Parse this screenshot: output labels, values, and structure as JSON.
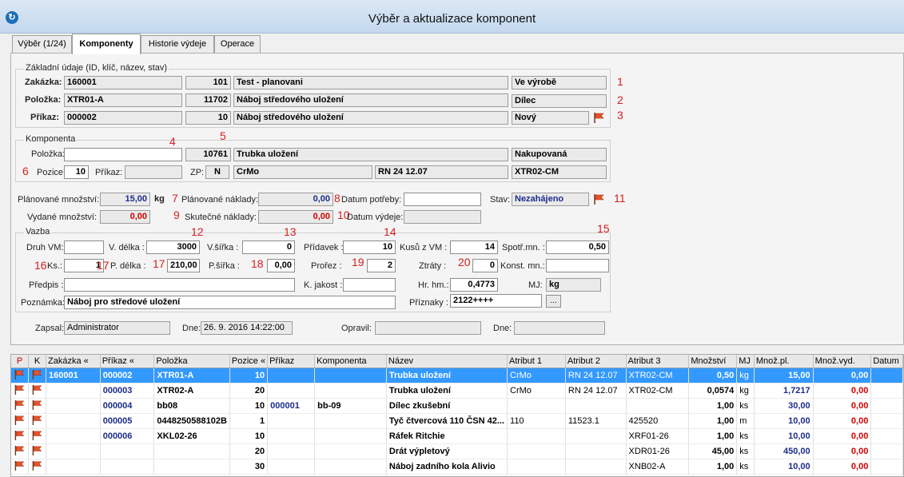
{
  "window": {
    "title": "Výběr a aktualizace komponent",
    "icon": "app-logo-icon"
  },
  "tabs": [
    {
      "label": "Výběr (1/24)"
    },
    {
      "label": "Komponenty",
      "active": true
    },
    {
      "label": "Historie výdeje"
    },
    {
      "label": "Operace"
    }
  ],
  "basic": {
    "title": "Základní údaje (ID, klíč, název, stav)",
    "zakazka": {
      "label": "Zakázka:",
      "code": "160001",
      "id": "101",
      "name": "Test - planovani",
      "state": "Ve výrobě",
      "marker": "1"
    },
    "polozka": {
      "label": "Položka:",
      "code": "XTR01-A",
      "id": "11702",
      "name": "Náboj středového uložení",
      "state": "Dílec",
      "marker": "2"
    },
    "prikaz": {
      "label": "Příkaz:",
      "code": "000002",
      "id": "10",
      "name": "Náboj středového uložení",
      "state": "Nový",
      "marker": "3"
    }
  },
  "komponenta": {
    "title": "Komponenta",
    "polozka_label": "Položka:",
    "polozka_value": "",
    "marker4": "4",
    "id": "10761",
    "marker5": "5",
    "name": "Trubka uložení",
    "type": "Nakupovaná",
    "marker6": "6",
    "pozice_label": "Pozice:",
    "pozice": "10",
    "prikaz_label": "Příkaz:",
    "prikaz": "",
    "zp_label": "ZP:",
    "zp": "N",
    "material": "CrMo",
    "norm": "RN 24 12.07",
    "code": "XTR02-CM"
  },
  "qty": {
    "planned_label": "Plánované množství:",
    "planned": "15,00",
    "unit": "kg",
    "issued_label": "Vydané množství:",
    "issued": "0,00",
    "m7": "7",
    "planned_cost_label": "Plánované náklady:",
    "planned_cost": "0,00",
    "m8": "8",
    "need_date_label": "Datum potřeby:",
    "need_date": "",
    "stav_label": "Stav:",
    "stav": "Nezahájeno",
    "m11": "11",
    "m9": "9",
    "actual_cost_label": "Skutečné náklady:",
    "actual_cost": "0,00",
    "m10": "10",
    "issue_date_label": "Datum výdeje:",
    "issue_date": ""
  },
  "vazba": {
    "title": "Vazba",
    "m12": "12",
    "m13": "13",
    "m14": "14",
    "m15": "15",
    "m16": "16",
    "m17": "17",
    "m18": "18",
    "m19": "19",
    "m20": "20",
    "druh_vm_label": "Druh VM:",
    "druh_vm": "",
    "v_delka_label": "V. délka :",
    "v_delka": "3000",
    "v_sirka_label": "V.šířka :",
    "v_sirka": "0",
    "pridavek_label": "Přídavek :",
    "pridavek": "10",
    "kusu_label": "Kusů z VM :",
    "kusu": "14",
    "spotr_label": "Spotř.mn. :",
    "spotr": "0,50",
    "ks_label": "Ks.:",
    "ks": "1",
    "p_delka_label": "P. délka :",
    "p_delka": "210,00",
    "p_sirka_label": "P.šířka :",
    "p_sirka": "0,00",
    "prorez_label": "Prořez :",
    "prorez": "2",
    "ztraty_label": "Ztráty :",
    "ztraty": "0",
    "konst_label": "Konst. mn.:",
    "konst": "",
    "predpis_label": "Předpis :",
    "predpis": "",
    "kjakost_label": "K. jakost :",
    "kjakost": "",
    "hrhm_label": "Hr. hm.:",
    "hrhm": "0,4773",
    "mj_label": "MJ:",
    "mj": "kg",
    "poznamka_label": "Poznámka:",
    "poznamka": "Náboj pro středové uložení",
    "priznaky_label": "Příznaky :",
    "priznaky": "2122++++",
    "browse_label": "..."
  },
  "audit": {
    "zapsal_label": "Zapsal:",
    "zapsal": "Administrator",
    "dne_label": "Dne:",
    "dne": "26. 9. 2016 14:22:00",
    "opravil_label": "Opravil:",
    "opravil": "",
    "dne2_label": "Dne:",
    "dne2": ""
  },
  "grid": {
    "columns": [
      "P",
      "K",
      "Zakázka «",
      "Příkaz «",
      "Položka",
      "Pozice «",
      "Příkaz",
      "Komponenta",
      "Název",
      "Atribut 1",
      "Atribut 2",
      "Atribut 3",
      "Množství",
      "MJ",
      "Množ.pl.",
      "Množ.vyd.",
      "Datum"
    ],
    "rows": [
      {
        "zakazka": "160001",
        "prikaz": "000002",
        "polozka": "XTR01-A",
        "pozice": "10",
        "prikaz2": "",
        "komponenta": "",
        "nazev": "Trubka uložení",
        "a1": "CrMo",
        "a2": "RN 24 12.07",
        "a3": "XTR02-CM",
        "mnozstvi": "0,50",
        "mj": "kg",
        "mnozpl": "15,00",
        "mnozvyd": "0,00",
        "selected": true
      },
      {
        "zakazka": "",
        "prikaz": "000003",
        "polozka": "XTR02-A",
        "pozice": "20",
        "prikaz2": "",
        "komponenta": "",
        "nazev": "Trubka uložení",
        "a1": "CrMo",
        "a2": "RN 24 12.07",
        "a3": "XTR02-CM",
        "mnozstvi": "0,0574",
        "mj": "kg",
        "mnozpl": "1,7217",
        "mnozvyd": "0,00"
      },
      {
        "zakazka": "",
        "prikaz": "000004",
        "polozka": "bb08",
        "pozice": "10",
        "prikaz2": "000001",
        "komponenta": "bb-09",
        "nazev": "Dílec zkušební",
        "a1": "",
        "a2": "",
        "a3": "",
        "mnozstvi": "1,00",
        "mj": "ks",
        "mnozpl": "30,00",
        "mnozvyd": "0,00"
      },
      {
        "zakazka": "",
        "prikaz": "000005",
        "polozka": "0448250588102B",
        "pozice": "1",
        "prikaz2": "",
        "komponenta": "",
        "nazev": "Tyč čtvercová 110 ČSN 42...",
        "a1": "110",
        "a2": "11523.1",
        "a3": "425520",
        "mnozstvi": "1,00",
        "mj": "m",
        "mnozpl": "10,00",
        "mnozvyd": "0,00"
      },
      {
        "zakazka": "",
        "prikaz": "000006",
        "polozka": "XKL02-26",
        "pozice": "10",
        "prikaz2": "",
        "komponenta": "",
        "nazev": "Ráfek Ritchie",
        "a1": "",
        "a2": "",
        "a3": "XRF01-26",
        "mnozstvi": "1,00",
        "mj": "ks",
        "mnozpl": "10,00",
        "mnozvyd": "0,00"
      },
      {
        "zakazka": "",
        "prikaz": "",
        "polozka": "",
        "pozice": "20",
        "prikaz2": "",
        "komponenta": "",
        "nazev": "Drát výpletový",
        "a1": "",
        "a2": "",
        "a3": "XDR01-26",
        "mnozstvi": "45,00",
        "mj": "ks",
        "mnozpl": "450,00",
        "mnozvyd": "0,00"
      },
      {
        "zakazka": "",
        "prikaz": "",
        "polozka": "",
        "pozice": "30",
        "prikaz2": "",
        "komponenta": "",
        "nazev": "Náboj zadního kola Alivio",
        "a1": "",
        "a2": "",
        "a3": "XNB02-A",
        "mnozstvi": "1,00",
        "mj": "ks",
        "mnozpl": "10,00",
        "mnozvyd": "0,00"
      }
    ]
  }
}
